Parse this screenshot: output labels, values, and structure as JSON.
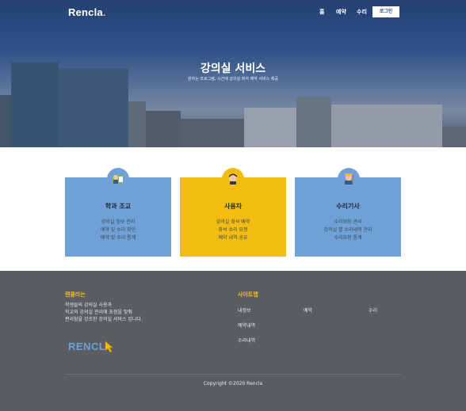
{
  "brand": {
    "name": "Rencla",
    "dot": "."
  },
  "nav": {
    "items": [
      "홈",
      "예약",
      "수리"
    ],
    "login_label": "로그인"
  },
  "hero": {
    "title": "강의실 서비스",
    "subtitle": "원하는 프로그램, 시간에 강의실 좌석 예약 서비스 제공"
  },
  "cards": [
    {
      "title": "학과 조교",
      "icon": "assistant-icon",
      "color": "#6fa1d6",
      "lines": [
        "강의실 정보 관리",
        "예약 및 수리 확인",
        "예약 및 수리 통계"
      ]
    },
    {
      "title": "사용자",
      "icon": "user-icon",
      "color": "#f2bc10",
      "lines": [
        "강의실 좌석 예약",
        "좌석 수리 요청",
        "예약 내역 공유"
      ]
    },
    {
      "title": "수리기사",
      "icon": "technician-icon",
      "color": "#6fa1d6",
      "lines": [
        "수리요청 관리",
        "강의실 별 수리내역 관리",
        "수리요청 통계"
      ]
    }
  ],
  "footer": {
    "about_heading": "렌클라는",
    "about_lines": [
      "학생들의 강의실 사용과",
      "학교의 강의실 관리에 초점을 맞춰",
      "편리함을 강조한 강의실 서비스 입니다."
    ],
    "logo_text": "RENCL",
    "sitemap_heading": "사이트맵",
    "sitemap_links": [
      "내정보",
      "예약",
      "수리",
      "예약내역",
      "수리내역"
    ],
    "copyright": "Copyright ©2020 Rencla"
  },
  "colors": {
    "accent_yellow": "#f2bc10",
    "card_blue": "#6fa1d6",
    "footer_bg": "#5a5d61",
    "hero_blue": "#2c4f8c"
  }
}
